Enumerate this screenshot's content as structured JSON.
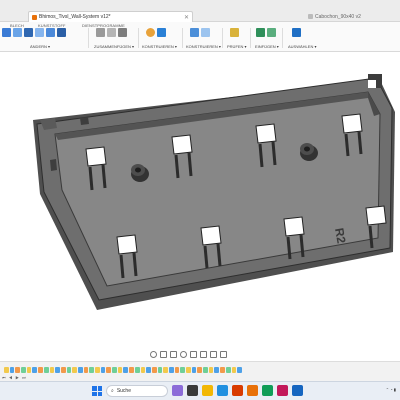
{
  "tabs": [
    {
      "label": "Bhimos_Tivsl_Wall-System v12*",
      "active": true
    },
    {
      "label": "Cabochon_90x40 v2",
      "active": false
    }
  ],
  "ribbon": {
    "tabs": [
      "BLECH",
      "KUNSTSTOFF",
      "DIENSTPROGRAMME"
    ],
    "groups": [
      "ÄNDERN ▾",
      "ZUSAMMENFÜGEN ▾",
      "KONSTRUIEREN ▾",
      "KONSTRUIEREN ▾",
      "PRÜFEN ▾",
      "EINFÜGEN ▾",
      "AUSWÄHLEN ▾"
    ]
  },
  "model": {
    "engraving": "R2",
    "colors": {
      "outer": "#5d5d5d",
      "face": "#757575",
      "floor": "#8a8a8a",
      "edge": "#2e2e2e",
      "wall": "#454545"
    }
  },
  "taskbar": {
    "search_placeholder": "Suche"
  }
}
